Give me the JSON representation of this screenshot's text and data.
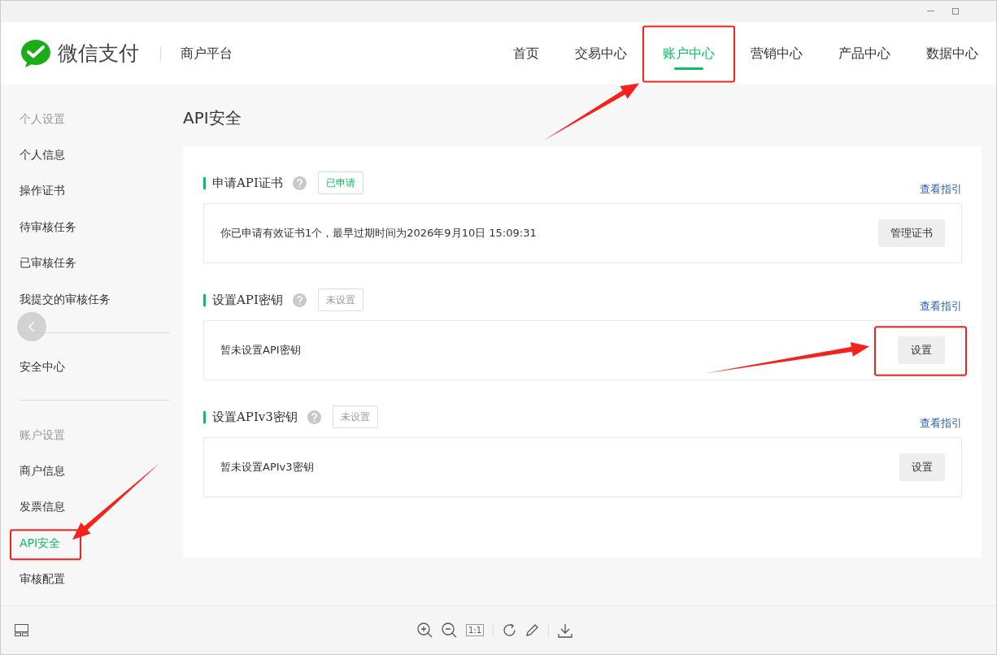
{
  "brand": {
    "name": "微信支付",
    "subtitle": "商户平台"
  },
  "nav": [
    {
      "label": "首页",
      "selected": false,
      "highlighted": false
    },
    {
      "label": "交易中心",
      "selected": false,
      "highlighted": false
    },
    {
      "label": "账户中心",
      "selected": true,
      "highlighted": true
    },
    {
      "label": "营销中心",
      "selected": false,
      "highlighted": false
    },
    {
      "label": "产品中心",
      "selected": false,
      "highlighted": false
    },
    {
      "label": "数据中心",
      "selected": false,
      "highlighted": false
    }
  ],
  "sidebar": [
    {
      "heading": "个人设置",
      "items": [
        {
          "label": "个人信息",
          "selected": false,
          "highlighted": false
        },
        {
          "label": "操作证书",
          "selected": false,
          "highlighted": false
        },
        {
          "label": "待审核任务",
          "selected": false,
          "highlighted": false
        },
        {
          "label": "已审核任务",
          "selected": false,
          "highlighted": false
        },
        {
          "label": "我提交的审核任务",
          "selected": false,
          "highlighted": false
        }
      ]
    },
    {
      "items": [
        {
          "label": "安全中心",
          "selected": false,
          "highlighted": false
        }
      ]
    },
    {
      "heading": "账户设置",
      "items": [
        {
          "label": "商户信息",
          "selected": false,
          "highlighted": false
        },
        {
          "label": "发票信息",
          "selected": false,
          "highlighted": false
        },
        {
          "label": "API安全",
          "selected": true,
          "highlighted": true
        },
        {
          "label": "审核配置",
          "selected": false,
          "highlighted": false
        }
      ]
    }
  ],
  "page_title": "API安全",
  "sections": [
    {
      "title": "申请API证书",
      "status": "已申请",
      "applied": true,
      "guide_link": "查看指引",
      "message": "你已申请有效证书1个，最早过期时间为2026年9月10日 15:09:31",
      "button": "管理证书",
      "highlighted": false
    },
    {
      "title": "设置API密钥",
      "status": "未设置",
      "applied": false,
      "guide_link": "查看指引",
      "message": "暂未设置API密钥",
      "button": "设置",
      "highlighted": true
    },
    {
      "title": "设置APIv3密钥",
      "status": "未设置",
      "applied": false,
      "guide_link": "查看指引",
      "message": "暂未设置APIv3密钥",
      "button": "设置",
      "highlighted": false
    }
  ],
  "toolbar": {
    "actual_size_label": "1:1"
  }
}
